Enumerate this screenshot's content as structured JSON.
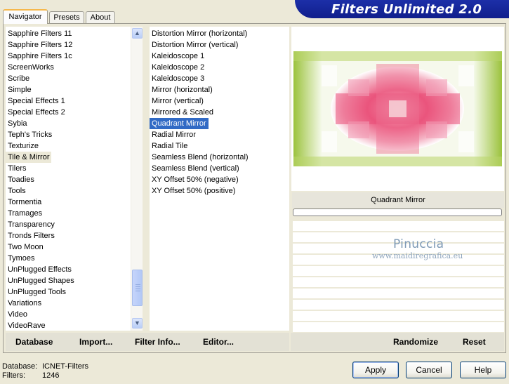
{
  "tabs": [
    "Navigator",
    "Presets",
    "About"
  ],
  "app_title": "Filters Unlimited 2.0",
  "categories": {
    "items": [
      "Sapphire Filters 11",
      "Sapphire Filters 12",
      "Sapphire Filters 1c",
      "ScreenWorks",
      "Scribe",
      "Simple",
      "Special Effects 1",
      "Special Effects 2",
      "Sybia",
      "Teph's Tricks",
      "Texturize",
      "Tile & Mirror",
      "Tilers",
      "Toadies",
      "Tools",
      "Tormentia",
      "Tramages",
      "Transparency",
      "Tronds Filters",
      "Two Moon",
      "Tymoes",
      "UnPlugged Effects",
      "UnPlugged Shapes",
      "UnPlugged Tools",
      "Variations",
      "Video",
      "VideoRave"
    ],
    "selected": "Tile & Mirror"
  },
  "filters": {
    "items": [
      "Distortion Mirror (horizontal)",
      "Distortion Mirror (vertical)",
      "Kaleidoscope 1",
      "Kaleidoscope 2",
      "Kaleidoscope 3",
      "Mirror (horizontal)",
      "Mirror (vertical)",
      "Mirrored & Scaled",
      "Quadrant Mirror",
      "Radial Mirror",
      "Radial Tile",
      "Seamless Blend (horizontal)",
      "Seamless Blend (vertical)",
      "XY Offset 50% (negative)",
      "XY Offset 50% (positive)"
    ],
    "selected": "Quadrant Mirror"
  },
  "preview": {
    "caption": "Quadrant Mirror"
  },
  "watermark": {
    "name": "Pinuccia",
    "url": "www.maidiregrafica.eu"
  },
  "toolbar": {
    "database": "Database",
    "import": "Import...",
    "filter_info": "Filter Info...",
    "editor": "Editor...",
    "randomize": "Randomize",
    "reset": "Reset"
  },
  "status": {
    "database_label": "Database:",
    "database_value": "ICNET-Filters",
    "filters_label": "Filters:",
    "filters_value": "1246"
  },
  "buttons": {
    "apply": "Apply",
    "cancel": "Cancel",
    "help": "Help"
  },
  "colors": {
    "selection": "#316AC5",
    "banner": "#101E8C",
    "window": "#ECE9D8"
  }
}
